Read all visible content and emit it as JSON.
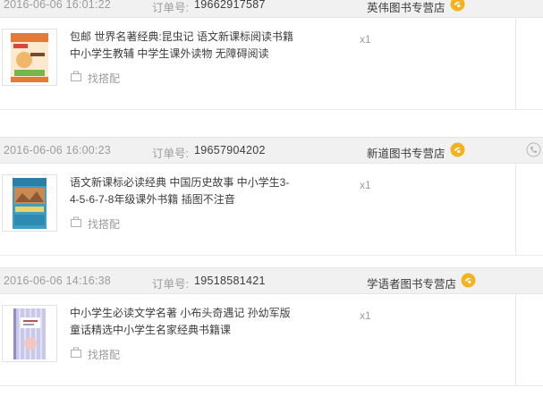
{
  "orders": [
    {
      "date": "2016-06-06 16:01:22",
      "order_no_label": "订单号:",
      "order_no": "19662917587",
      "shop": "英伟图书专营店",
      "title": "包邮 世界名著经典:昆虫记 语文新课标阅读书籍 中小学生教辅 中学生课外读物 无障碍阅读",
      "match_label": "找搭配",
      "qty": "x1",
      "phone_icon": false
    },
    {
      "date": "2016-06-06 16:00:23",
      "order_no_label": "订单号:",
      "order_no": "19657904202",
      "shop": "新道图书专营店",
      "title": "语文新课标必读经典 中国历史故事 中小学生3-4-5-6-7-8年级课外书籍 插图不注音",
      "match_label": "找搭配",
      "qty": "x1",
      "phone_icon": true
    },
    {
      "date": "2016-06-06 14:16:38",
      "order_no_label": "订单号:",
      "order_no": "19518581421",
      "shop": "学语者图书专营店",
      "title": "中小学生必读文学名著 小布头奇遇记 孙幼军版童话精选中小学生名家经典书籍课",
      "match_label": "找搭配",
      "qty": "x1",
      "phone_icon": false
    }
  ],
  "colors": {
    "header_bg": "#f1f1f1",
    "muted_text": "#9c9c9c",
    "body_text": "#3c3c3c",
    "wangwang": "#f5b21d"
  },
  "icons": [
    "wangwang-icon",
    "phone-icon",
    "match-icon"
  ]
}
